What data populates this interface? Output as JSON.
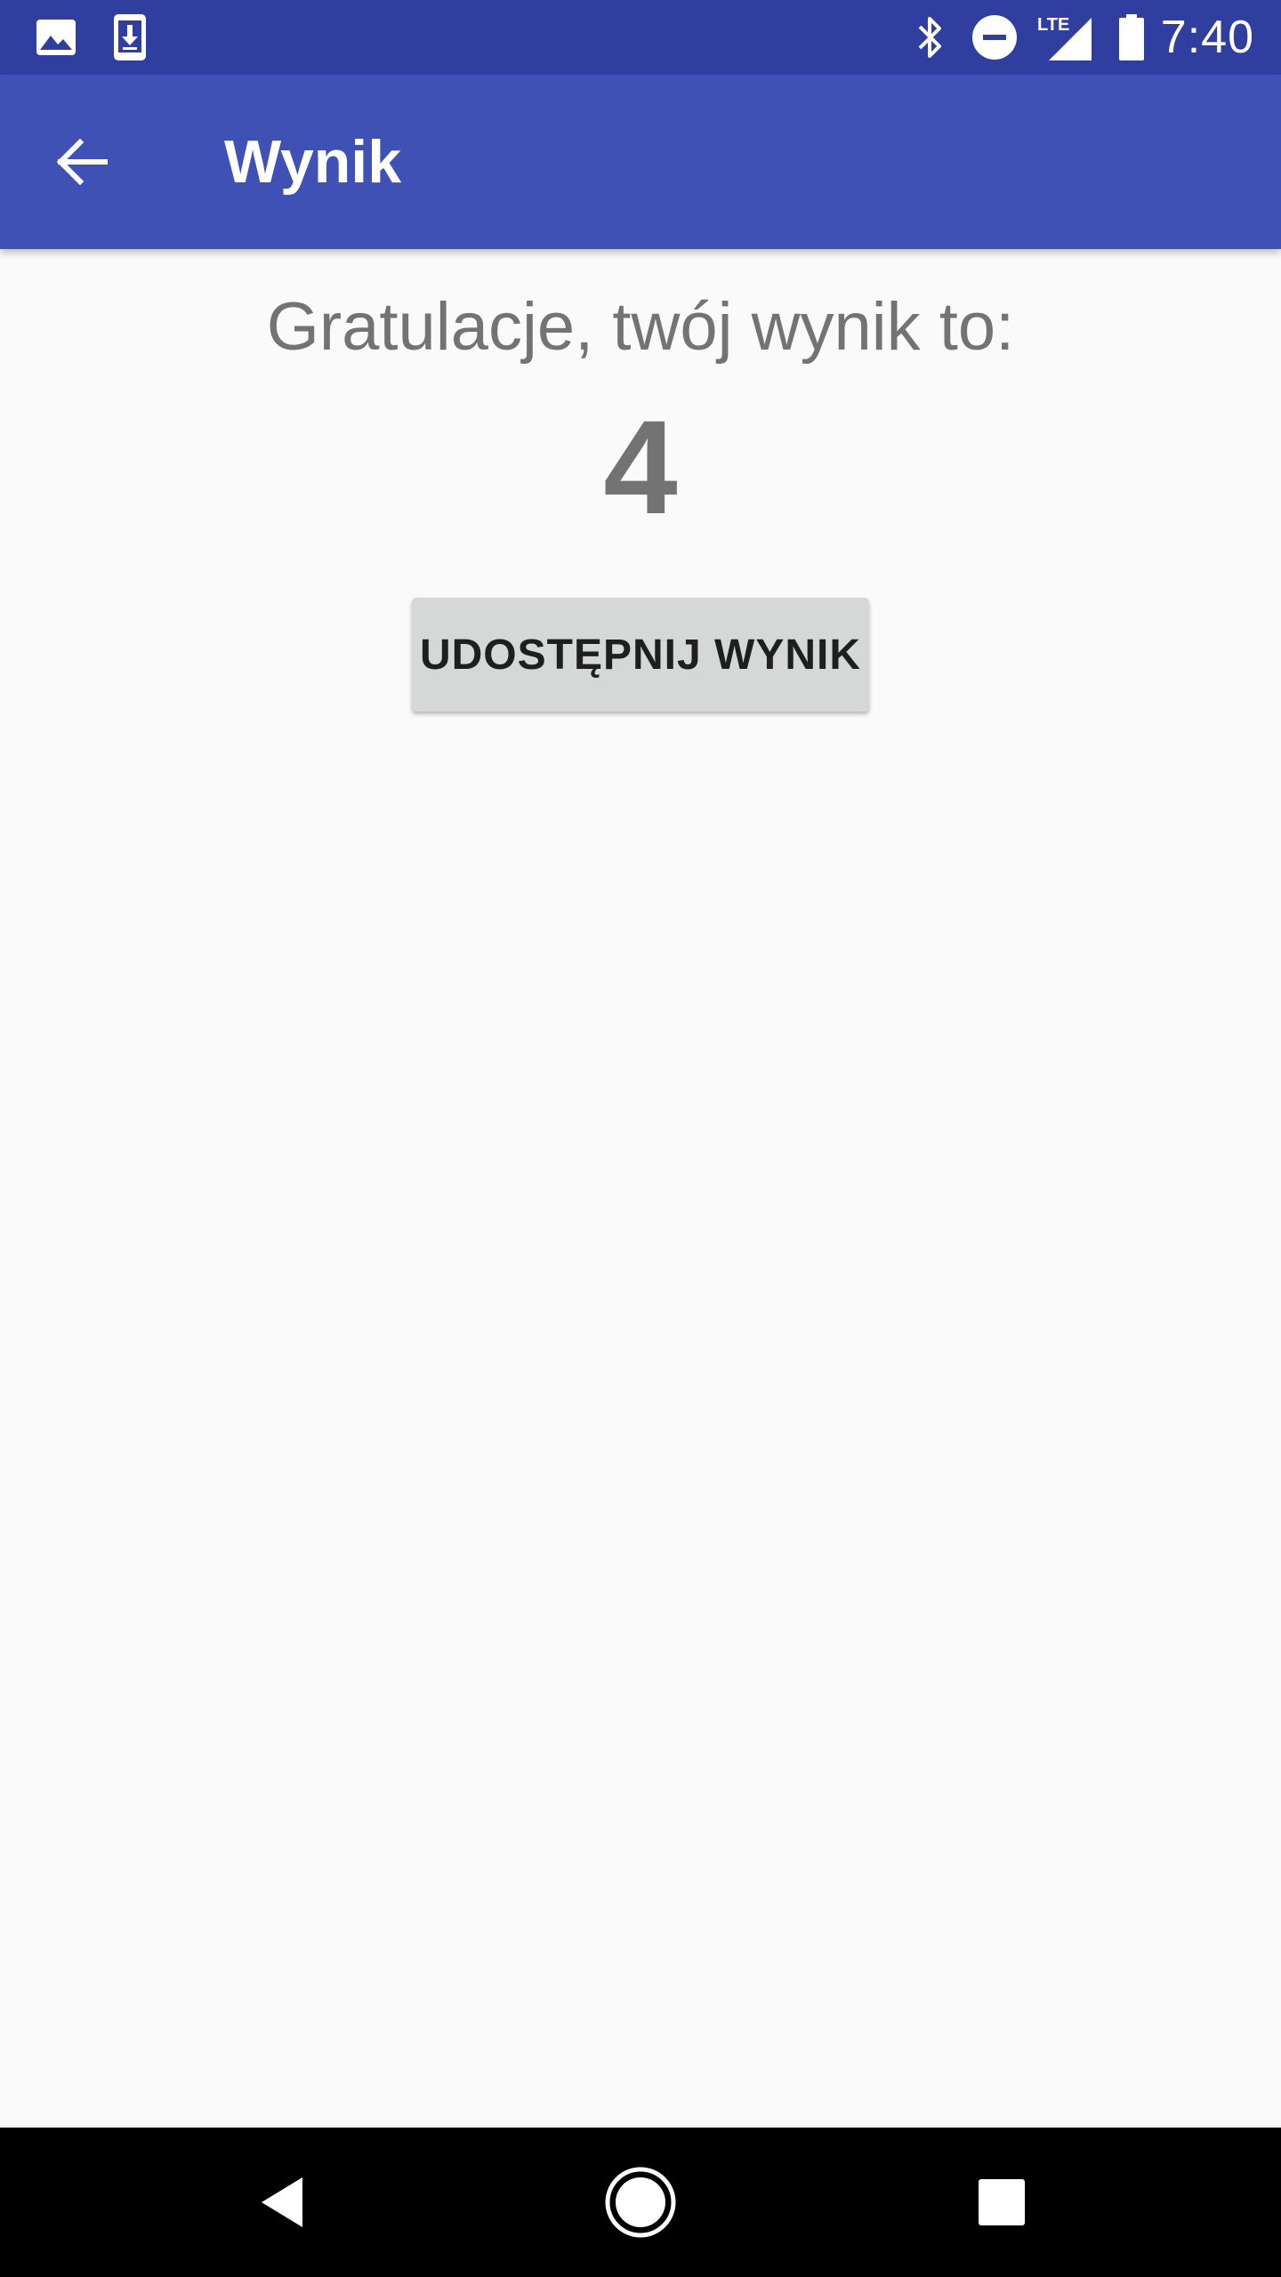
{
  "status_bar": {
    "time": "7:40",
    "icons": [
      "image-icon",
      "download-icon",
      "bluetooth-icon",
      "do-not-disturb-icon",
      "lte-signal-icon",
      "battery-icon"
    ],
    "lte_label": "LTE"
  },
  "app_bar": {
    "title": "Wynik",
    "back_icon": "arrow-back-icon"
  },
  "content": {
    "congrats_text": "Gratulacje, twój wynik to:",
    "score": "4",
    "share_button_label": "UDOSTĘPNIJ WYNIK"
  },
  "nav_bar": {
    "buttons": [
      "back-triangle-icon",
      "home-circle-icon",
      "recents-square-icon"
    ]
  },
  "colors": {
    "status_bar": "#303f9f",
    "app_bar": "#3f51b5",
    "background": "#fafafa",
    "text_secondary": "#737373",
    "button_bg": "#d6d7d7"
  }
}
